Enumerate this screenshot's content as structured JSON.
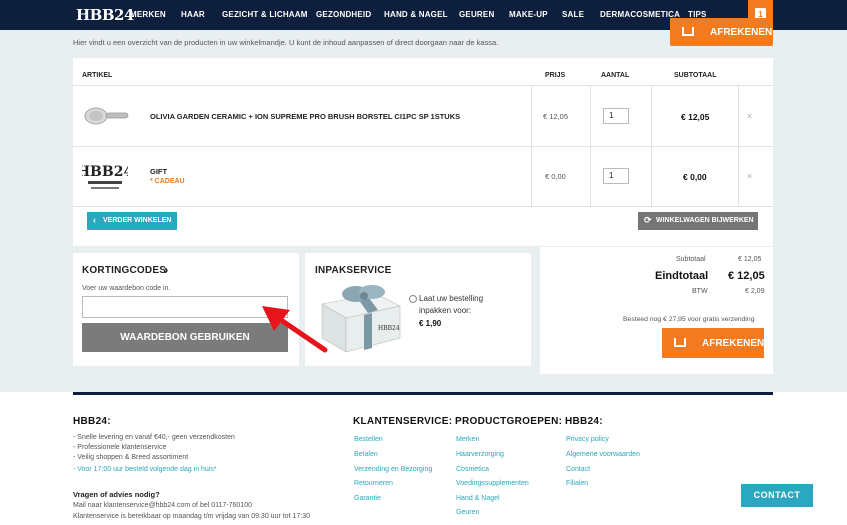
{
  "brand": "HBB24",
  "nav": [
    "MERKEN",
    "HAAR",
    "GEZICHT & LICHAAM",
    "GEZONDHEID",
    "HAND & NAGEL",
    "GEUREN",
    "MAKE-UP",
    "SALE",
    "DERMACOSMETICA",
    "TIPS"
  ],
  "cart_count": "1",
  "intro": "Hier vindt u een overzicht van de producten in uw winkelmandje. U kunt de inhoud aanpassen of direct doorgaan naar de kassa.",
  "checkout_label": "AFREKENEN",
  "table": {
    "headers": {
      "item": "ARTIKEL",
      "price": "PRIJS",
      "qty": "AANTAL",
      "subtotal": "SUBTOTAAL"
    },
    "rows": [
      {
        "name": "OLIVIA GARDEN CERAMIC + ION SUPREME PRO BRUSH BORSTEL CI1PC SP 1STUKS",
        "note": "",
        "price": "€ 12,05",
        "qty": "1",
        "subtotal": "€ 12,05"
      },
      {
        "name": "GIFT",
        "note": "* CADEAU",
        "price": "€ 0,00",
        "qty": "1",
        "subtotal": "€ 0,00"
      }
    ],
    "remove_glyph": "×"
  },
  "buttons": {
    "continue": "VERDER WINKELEN",
    "update": "WINKELWAGEN BIJWERKEN"
  },
  "coupon": {
    "title": "KORTINGCODES",
    "chevron": "›",
    "hint": "Voer uw waardebon code in.",
    "button": "WAARDEBON GEBRUIKEN",
    "value": ""
  },
  "giftwrap": {
    "title": "INPAKSERVICE",
    "text": "Laat uw bestelling inpakken voor:",
    "price": "€ 1,90"
  },
  "totals": {
    "subtotal_label": "Subtotaal",
    "subtotal": "€ 12,05",
    "total_label": "Eindtotaal",
    "total": "€ 12,05",
    "vat_label": "BTW",
    "vat": "€ 2,09",
    "free_shipping": "Besteed nog € 27,95 voor gratis verzending"
  },
  "footer": {
    "col1": {
      "title": "HBB24:",
      "lines": [
        "- Snelle levering en vanaf €40,- geen verzendkosten",
        "- Professionele klantenservice",
        "- Veilig shoppen & Breed assortiment"
      ],
      "link": "- Voor 17:00 uur besteld volgende dag in huis*",
      "q_title": "Vragen of advies nodig?",
      "q_lines": [
        "Mail naar klantenservice@hbb24.com of bel 0117-760100",
        "Klantenservice is bereikbaar op maandag t/m vrijdag van 09:30 uur tot 17:30"
      ]
    },
    "col2": {
      "title": "KLANTENSERVICE:",
      "links": [
        "Bestellen",
        "Betalen",
        "Verzending en Bezorging",
        "Retourneren",
        "Garantie"
      ]
    },
    "col3": {
      "title": "PRODUCTGROEPEN:",
      "links": [
        "Merken",
        "Haarverzorging",
        "Cosmetica",
        "Voedingssupplementen",
        "Hand & Nagel",
        "Geuren"
      ]
    },
    "col4": {
      "title": "HBB24:",
      "links": [
        "Privacy policy",
        "Algemene voorwaarden",
        "Contact",
        "Filialen"
      ]
    }
  },
  "contact_button": "CONTACT",
  "colors": {
    "navy": "#0d1f3c",
    "orange": "#f47a20",
    "teal": "#2aa8c0",
    "grey_button": "#757575",
    "arrow": "#e8141c"
  }
}
